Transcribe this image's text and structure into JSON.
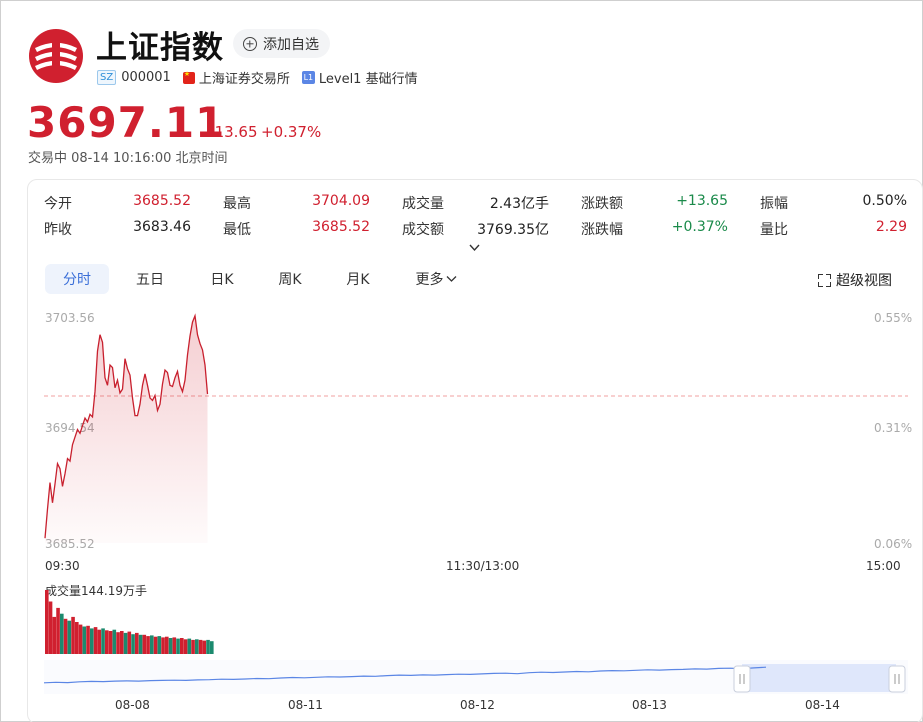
{
  "header": {
    "title": "上证指数",
    "add_button": "添加自选",
    "market_tag": "SZ",
    "code": "000001",
    "exchange": "上海证券交易所",
    "level_tag": "L1",
    "level_text": "Level1 基础行情"
  },
  "quote": {
    "price": "3697.11",
    "change": "+13.65",
    "change_pct": "+0.37%",
    "status": "交易中  08-14 10:16:00 北京时间"
  },
  "stats": [
    {
      "label": "今开",
      "value": "3685.52",
      "color": "red"
    },
    {
      "label": "最高",
      "value": "3704.09",
      "color": "red"
    },
    {
      "label": "成交量",
      "value": "2.43亿手",
      "color": "dark"
    },
    {
      "label": "涨跌额",
      "value": "+13.65",
      "color": "green"
    },
    {
      "label": "振幅",
      "value": "0.50%",
      "color": "dark"
    },
    {
      "label": "昨收",
      "value": "3683.46",
      "color": "dark"
    },
    {
      "label": "最低",
      "value": "3685.52",
      "color": "red"
    },
    {
      "label": "成交额",
      "value": "3769.35亿",
      "color": "dark"
    },
    {
      "label": "涨跌幅",
      "value": "+0.37%",
      "color": "green"
    },
    {
      "label": "量比",
      "value": "2.29",
      "color": "red"
    }
  ],
  "tabs": [
    "分时",
    "五日",
    "日K",
    "周K",
    "月K",
    "更多"
  ],
  "active_tab": "分时",
  "super_view": "超级视图",
  "colors": {
    "up": "#d0202f",
    "down": "#1a8a4a",
    "accent": "#3b6fd8"
  },
  "chart_data": {
    "type": "line",
    "title": "",
    "y_left_ticks": [
      "3703.56",
      "3694.54",
      "3685.52"
    ],
    "y_right_ticks": [
      "0.55%",
      "0.31%",
      "0.06%"
    ],
    "ylim": [
      3685.52,
      3703.56
    ],
    "prev_close": 3683.46,
    "x_ticks": [
      "09:30",
      "11:30/13:00",
      "15:00"
    ],
    "total_minutes": 240,
    "series": [
      {
        "values": [
          3685.9,
          3688.2,
          3690.3,
          3688.7,
          3690.2,
          3691.8,
          3691.4,
          3690.0,
          3691.0,
          3692.2,
          3692.0,
          3693.3,
          3693.9,
          3694.5,
          3694.2,
          3694.8,
          3695.4,
          3695.1,
          3695.7,
          3695.5,
          3697.5,
          3700.7,
          3702.0,
          3701.4,
          3698.6,
          3698.0,
          3699.6,
          3699.4,
          3697.8,
          3698.4,
          3697.4,
          3697.7,
          3700.1,
          3699.3,
          3698.8,
          3697.0,
          3695.6,
          3695.6,
          3696.5,
          3698.0,
          3698.9,
          3698.0,
          3697.0,
          3696.8,
          3697.2,
          3696.0,
          3696.5,
          3698.1,
          3699.2,
          3699.0,
          3698.0,
          3697.9,
          3698.6,
          3699.1,
          3698.0,
          3697.5,
          3698.4,
          3700.4,
          3701.9,
          3703.0,
          3703.5,
          3702.0,
          3701.3,
          3700.8,
          3699.6,
          3697.3
        ]
      }
    ]
  },
  "volume": {
    "label": "成交量144.19万手",
    "bars": [
      {
        "v": 100,
        "up": true
      },
      {
        "v": 82,
        "up": true
      },
      {
        "v": 58,
        "up": true
      },
      {
        "v": 72,
        "up": true
      },
      {
        "v": 63,
        "up": false
      },
      {
        "v": 55,
        "up": true
      },
      {
        "v": 52,
        "up": false
      },
      {
        "v": 58,
        "up": true
      },
      {
        "v": 50,
        "up": true
      },
      {
        "v": 46,
        "up": true
      },
      {
        "v": 43,
        "up": false
      },
      {
        "v": 44,
        "up": true
      },
      {
        "v": 40,
        "up": false
      },
      {
        "v": 42,
        "up": true
      },
      {
        "v": 38,
        "up": true
      },
      {
        "v": 40,
        "up": false
      },
      {
        "v": 37,
        "up": true
      },
      {
        "v": 36,
        "up": true
      },
      {
        "v": 38,
        "up": false
      },
      {
        "v": 34,
        "up": true
      },
      {
        "v": 36,
        "up": true
      },
      {
        "v": 33,
        "up": false
      },
      {
        "v": 35,
        "up": true
      },
      {
        "v": 31,
        "up": false
      },
      {
        "v": 33,
        "up": true
      },
      {
        "v": 30,
        "up": false
      },
      {
        "v": 30,
        "up": true
      },
      {
        "v": 28,
        "up": true
      },
      {
        "v": 29,
        "up": false
      },
      {
        "v": 27,
        "up": true
      },
      {
        "v": 28,
        "up": false
      },
      {
        "v": 26,
        "up": true
      },
      {
        "v": 27,
        "up": true
      },
      {
        "v": 25,
        "up": false
      },
      {
        "v": 26,
        "up": true
      },
      {
        "v": 24,
        "up": false
      },
      {
        "v": 25,
        "up": true
      },
      {
        "v": 23,
        "up": true
      },
      {
        "v": 24,
        "up": false
      },
      {
        "v": 22,
        "up": true
      },
      {
        "v": 23,
        "up": false
      },
      {
        "v": 22,
        "up": true
      },
      {
        "v": 21,
        "up": true
      },
      {
        "v": 22,
        "up": false
      },
      {
        "v": 20,
        "up": false
      }
    ]
  },
  "navigator": {
    "dates": [
      "08-08",
      "08-11",
      "08-12",
      "08-13",
      "08-14"
    ],
    "line": [
      0.3,
      0.32,
      0.31,
      0.34,
      0.36,
      0.35,
      0.37,
      0.38,
      0.37,
      0.39,
      0.4,
      0.41,
      0.4,
      0.42,
      0.43,
      0.45,
      0.44,
      0.46,
      0.48,
      0.47,
      0.5,
      0.52,
      0.51,
      0.53,
      0.55,
      0.54,
      0.56,
      0.58,
      0.57,
      0.6,
      0.62,
      0.61,
      0.63,
      0.62,
      0.64,
      0.66,
      0.65,
      0.67,
      0.69,
      0.7,
      0.68,
      0.72,
      0.74,
      0.73,
      0.75,
      0.77,
      0.76,
      0.79,
      0.81,
      0.8,
      0.82,
      0.84,
      0.83,
      0.85,
      0.86,
      0.88,
      0.87,
      0.9,
      0.91,
      0.89,
      0.92,
      0.95
    ]
  }
}
